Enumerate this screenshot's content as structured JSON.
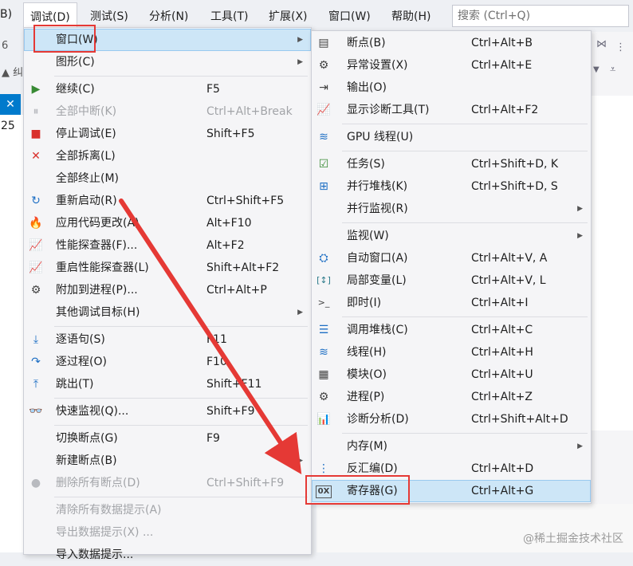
{
  "menubar": {
    "partial_left": "B)",
    "items": [
      "调试(D)",
      "测试(S)",
      "分析(N)",
      "工具(T)",
      "扩展(X)",
      "窗口(W)",
      "帮助(H)"
    ],
    "search_placeholder": "搜索 (Ctrl+Q)"
  },
  "background": {
    "left_num": "6",
    "left_glyph": "▲ 纠",
    "left_close": "✕",
    "left_line": "25"
  },
  "debug_menu": {
    "items": [
      {
        "label": "窗口(W)",
        "shortcut": "",
        "icon": "",
        "submenu": true,
        "highlighted": true
      },
      {
        "label": "图形(C)",
        "shortcut": "",
        "icon": "",
        "submenu": true
      },
      {
        "label": "继续(C)",
        "shortcut": "F5",
        "icon": "play-icon"
      },
      {
        "label": "全部中断(K)",
        "shortcut": "Ctrl+Alt+Break",
        "icon": "pause-icon",
        "disabled": true
      },
      {
        "label": "停止调试(E)",
        "shortcut": "Shift+F5",
        "icon": "stop-icon"
      },
      {
        "label": "全部拆离(L)",
        "shortcut": "",
        "icon": "close-icon"
      },
      {
        "label": "全部终止(M)",
        "shortcut": "",
        "icon": ""
      },
      {
        "label": "重新启动(R)",
        "shortcut": "Ctrl+Shift+F5",
        "icon": "restart-icon"
      },
      {
        "label": "应用代码更改(A)",
        "shortcut": "Alt+F10",
        "icon": "flame-icon"
      },
      {
        "label": "性能探查器(F)...",
        "shortcut": "Alt+F2",
        "icon": "chart-icon"
      },
      {
        "label": "重启性能探查器(L)",
        "shortcut": "Shift+Alt+F2",
        "icon": "chart-icon"
      },
      {
        "label": "附加到进程(P)...",
        "shortcut": "Ctrl+Alt+P",
        "icon": "gears-icon"
      },
      {
        "label": "其他调试目标(H)",
        "shortcut": "",
        "icon": "",
        "submenu": true
      },
      {
        "label": "逐语句(S)",
        "shortcut": "F11",
        "icon": "step-into-icon"
      },
      {
        "label": "逐过程(O)",
        "shortcut": "F10",
        "icon": "step-over-icon"
      },
      {
        "label": "跳出(T)",
        "shortcut": "Shift+F11",
        "icon": "step-out-icon"
      },
      {
        "label": "快速监视(Q)...",
        "shortcut": "Shift+F9",
        "icon": "glasses-icon"
      },
      {
        "label": "切换断点(G)",
        "shortcut": "F9",
        "icon": ""
      },
      {
        "label": "新建断点(B)",
        "shortcut": "",
        "icon": "",
        "submenu": true
      },
      {
        "label": "删除所有断点(D)",
        "shortcut": "Ctrl+Shift+F9",
        "icon": "delete-breakpoints-icon",
        "disabled": true
      },
      {
        "label": "清除所有数据提示(A)",
        "shortcut": "",
        "icon": "",
        "disabled": true
      },
      {
        "label": "导出数据提示(X) ...",
        "shortcut": "",
        "icon": "",
        "disabled": true
      },
      {
        "label": "导入数据提示...",
        "shortcut": "",
        "icon": ""
      }
    ]
  },
  "window_menu": {
    "items": [
      {
        "label": "断点(B)",
        "shortcut": "Ctrl+Alt+B",
        "icon": "breakpoints-icon"
      },
      {
        "label": "异常设置(X)",
        "shortcut": "Ctrl+Alt+E",
        "icon": "exception-settings-icon"
      },
      {
        "label": "输出(O)",
        "shortcut": "",
        "icon": "output-icon"
      },
      {
        "label": "显示诊断工具(T)",
        "shortcut": "Ctrl+Alt+F2",
        "icon": "diagnostics-icon"
      },
      {
        "label": "GPU 线程(U)",
        "shortcut": "",
        "icon": "gpu-threads-icon"
      },
      {
        "label": "任务(S)",
        "shortcut": "Ctrl+Shift+D, K",
        "icon": "tasks-icon"
      },
      {
        "label": "并行堆栈(K)",
        "shortcut": "Ctrl+Shift+D, S",
        "icon": "parallel-stacks-icon"
      },
      {
        "label": "并行监视(R)",
        "shortcut": "",
        "icon": "",
        "submenu": true
      },
      {
        "label": "监视(W)",
        "shortcut": "",
        "icon": "",
        "submenu": true
      },
      {
        "label": "自动窗口(A)",
        "shortcut": "Ctrl+Alt+V, A",
        "icon": "autos-icon"
      },
      {
        "label": "局部变量(L)",
        "shortcut": "Ctrl+Alt+V, L",
        "icon": "locals-icon"
      },
      {
        "label": "即时(I)",
        "shortcut": "Ctrl+Alt+I",
        "icon": "immediate-icon"
      },
      {
        "label": "调用堆栈(C)",
        "shortcut": "Ctrl+Alt+C",
        "icon": "call-stack-icon"
      },
      {
        "label": "线程(H)",
        "shortcut": "Ctrl+Alt+H",
        "icon": "threads-icon"
      },
      {
        "label": "模块(O)",
        "shortcut": "Ctrl+Alt+U",
        "icon": "modules-icon"
      },
      {
        "label": "进程(P)",
        "shortcut": "Ctrl+Alt+Z",
        "icon": "processes-icon"
      },
      {
        "label": "诊断分析(D)",
        "shortcut": "Ctrl+Shift+Alt+D",
        "icon": "diagnostic-analysis-icon"
      },
      {
        "label": "内存(M)",
        "shortcut": "",
        "icon": "",
        "submenu": true
      },
      {
        "label": "反汇编(D)",
        "shortcut": "Ctrl+Alt+D",
        "icon": "disassembly-icon"
      },
      {
        "label": "寄存器(G)",
        "shortcut": "Ctrl+Alt+G",
        "icon": "registers-icon",
        "highlighted": true
      }
    ]
  },
  "icons": {
    "play": "▶",
    "pause": "⏸",
    "stop": "■",
    "close": "✕",
    "restart": "↻",
    "flame": "🔥",
    "chart": "📈",
    "gears": "⚙",
    "step_into": "⤓",
    "step_over": "↷",
    "step_out": "⤒",
    "glasses": "👓",
    "delete_bp": "●",
    "submenu_arrow": "▶",
    "breakpoints": "▤",
    "exception": "⚙",
    "output": "⇥",
    "diag": "📈",
    "gpu": "≋",
    "tasks": "☑",
    "pstack": "⊞",
    "autos": "⛭",
    "locals": "[↕]",
    "immediate": ">_",
    "callstack": "☰",
    "threads": "≋",
    "modules": "▦",
    "processes": "⚙",
    "analysis": "📊",
    "disasm": "⋮",
    "registers": "0X"
  },
  "watermark": "@稀土掘金技术社区",
  "colors": {
    "highlight": "#cde6f7",
    "annotation_red": "#e53935"
  }
}
